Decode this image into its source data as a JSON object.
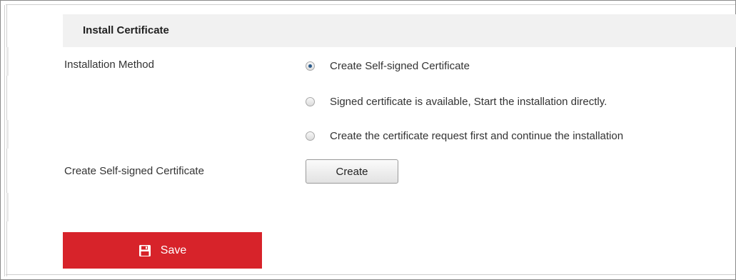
{
  "section": {
    "title": "Install Certificate"
  },
  "installation_method": {
    "label": "Installation Method",
    "options": [
      {
        "label": "Create Self-signed Certificate",
        "checked": true
      },
      {
        "label": "Signed certificate is available, Start the installation directly.",
        "checked": false
      },
      {
        "label": "Create the certificate request first and continue the installation",
        "checked": false
      }
    ]
  },
  "self_signed": {
    "label": "Create Self-signed Certificate",
    "button_label": "Create"
  },
  "footer": {
    "save_label": "Save",
    "save_icon": "floppy-disk-icon",
    "save_color": "#d7232a"
  }
}
